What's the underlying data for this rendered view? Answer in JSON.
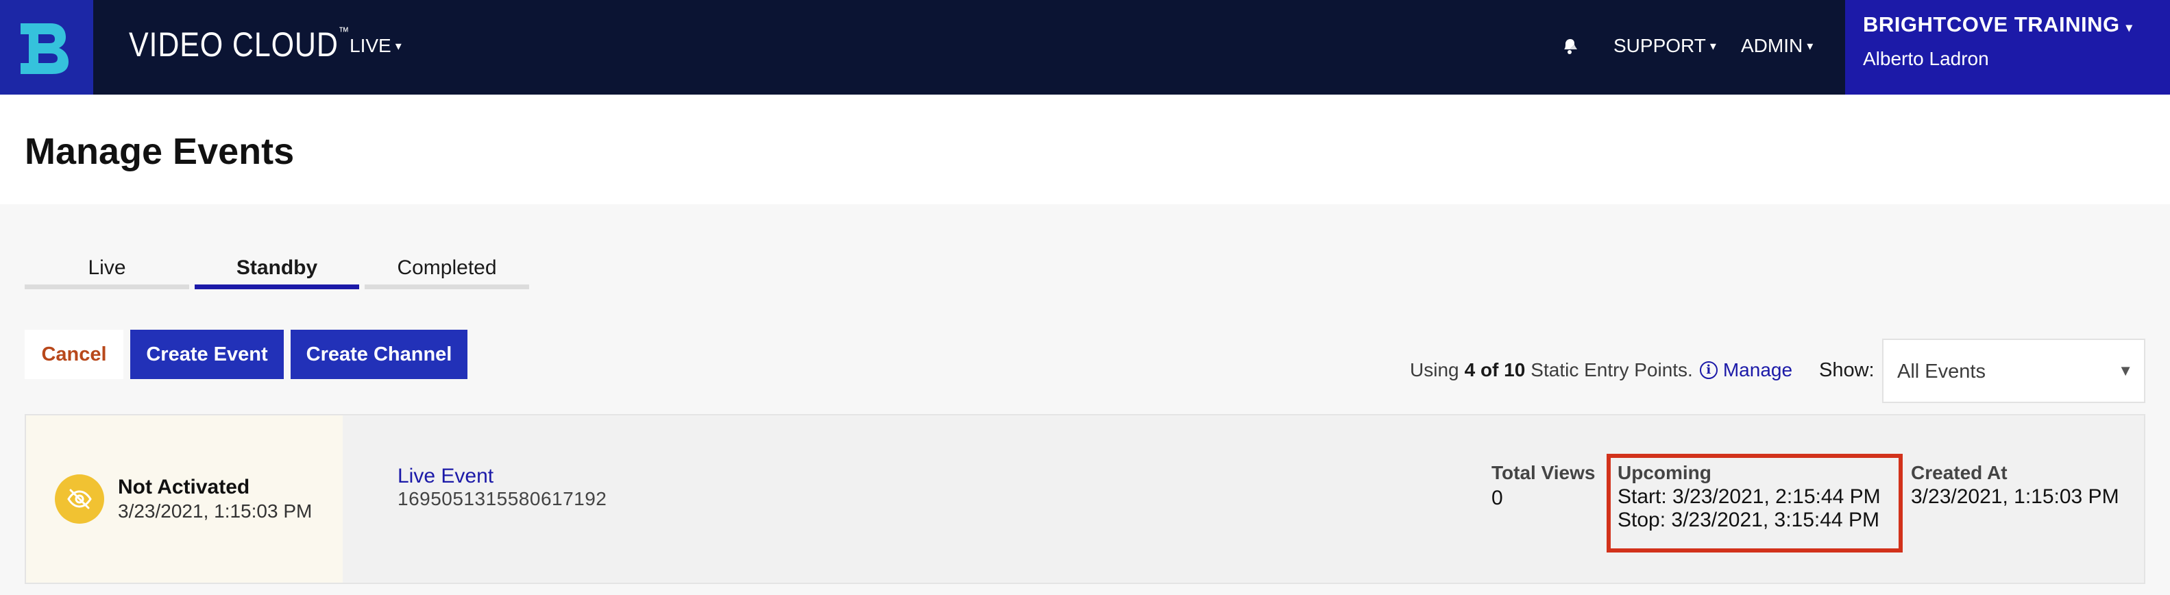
{
  "nav": {
    "logo_icon": "brightcove-logo-icon",
    "app_name": "VIDEO CLOUD",
    "app_name_tm": "™",
    "live_label": "LIVE",
    "support_label": "SUPPORT",
    "admin_label": "ADMIN",
    "notification_icon": "bell-icon",
    "caret": "▾",
    "account_name": "BRIGHTCOVE TRAINING",
    "account_user": "Alberto Ladron"
  },
  "page": {
    "title": "Manage Events"
  },
  "tabs": [
    {
      "label": "Live",
      "active": false
    },
    {
      "label": "Standby",
      "active": true
    },
    {
      "label": "Completed",
      "active": false
    }
  ],
  "actions": {
    "cancel_label": "Cancel",
    "create_event_label": "Create Event",
    "create_channel_label": "Create Channel"
  },
  "usage": {
    "prefix": "Using",
    "count": "4 of 10",
    "suffix": "Static Entry Points.",
    "info_icon": "info-icon",
    "manage_label": "Manage"
  },
  "filter": {
    "show_label": "Show:",
    "selected": "All Events",
    "caret": "▼"
  },
  "event": {
    "status_icon": "eye-off-icon",
    "status_title": "Not Activated",
    "status_date": "3/23/2021, 1:15:03 PM",
    "name": "Live Event",
    "id": "1695051315580617192",
    "views_label": "Total Views",
    "views_value": "0",
    "upcoming_label": "Upcoming",
    "start": "Start: 3/23/2021, 2:15:44 PM",
    "stop": "Stop: 3/23/2021, 3:15:44 PM",
    "created_label": "Created At",
    "created_value": "3/23/2021, 1:15:03 PM"
  },
  "colors": {
    "topbar": "#0b1433",
    "brand_blue": "#1c1aa8",
    "button_blue": "#2231b8",
    "cancel_text": "#b8481b",
    "highlight_border": "#d2321b",
    "status_yellow": "#f1c232"
  }
}
